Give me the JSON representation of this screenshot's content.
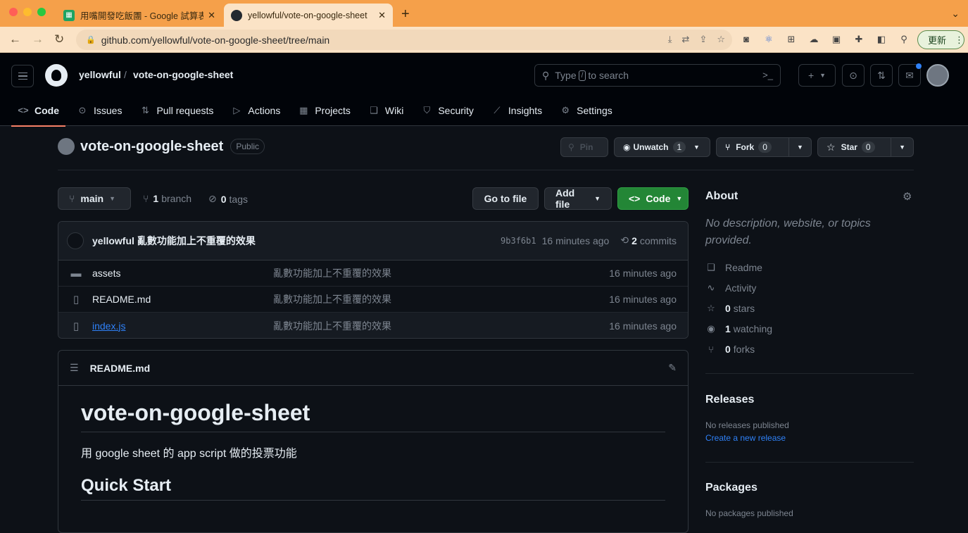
{
  "browser": {
    "tabs": [
      {
        "title": "用嘴開發吃飯團 - Google 試算表",
        "active": false
      },
      {
        "title": "yellowful/vote-on-google-sheet",
        "active": true
      }
    ],
    "url": "github.com/yellowful/vote-on-google-sheet/tree/main",
    "update_label": "更新"
  },
  "header": {
    "owner": "yellowful",
    "separator": "/",
    "repo": "vote-on-google-sheet",
    "search_before": "Type",
    "search_key": "/",
    "search_after": "to search"
  },
  "repo_nav": [
    {
      "label": "Code",
      "icon": "code-icon"
    },
    {
      "label": "Issues",
      "icon": "issue-icon"
    },
    {
      "label": "Pull requests",
      "icon": "pull-request-icon"
    },
    {
      "label": "Actions",
      "icon": "play-icon"
    },
    {
      "label": "Projects",
      "icon": "table-icon"
    },
    {
      "label": "Wiki",
      "icon": "book-icon"
    },
    {
      "label": "Security",
      "icon": "shield-icon"
    },
    {
      "label": "Insights",
      "icon": "graph-icon"
    },
    {
      "label": "Settings",
      "icon": "gear-icon"
    }
  ],
  "repo": {
    "name": "vote-on-google-sheet",
    "visibility": "Public",
    "pin_label": "Pin",
    "unwatch_label": "Unwatch",
    "watch_count": "1",
    "fork_label": "Fork",
    "fork_count": "0",
    "star_label": "Star",
    "star_count": "0"
  },
  "branch_bar": {
    "branch": "main",
    "branch_count": "1",
    "branch_label": "branch",
    "tag_count": "0",
    "tag_label": "tags",
    "go_to_file": "Go to file",
    "add_file": "Add file",
    "code": "Code"
  },
  "latest_commit": {
    "author": "yellowful",
    "message": "亂數功能加上不重覆的效果",
    "sha": "9b3f6b1",
    "age": "16 minutes ago",
    "commit_count": "2",
    "commit_label": "commits"
  },
  "files": [
    {
      "type": "folder",
      "name": "assets",
      "message": "亂數功能加上不重覆的效果",
      "age": "16 minutes ago"
    },
    {
      "type": "file",
      "name": "README.md",
      "message": "亂數功能加上不重覆的效果",
      "age": "16 minutes ago"
    },
    {
      "type": "file",
      "name": "index.js",
      "message": "亂數功能加上不重覆的效果",
      "age": "16 minutes ago"
    }
  ],
  "readme": {
    "filename": "README.md",
    "h1": "vote-on-google-sheet",
    "p": "用 google sheet 的 app script 做的投票功能",
    "h2": "Quick Start"
  },
  "about": {
    "title": "About",
    "description": "No description, website, or topics provided.",
    "items": [
      {
        "icon": "book-icon",
        "bold": "",
        "label": "Readme"
      },
      {
        "icon": "pulse-icon",
        "bold": "",
        "label": "Activity"
      },
      {
        "icon": "star-icon",
        "bold": "0",
        "label": "stars"
      },
      {
        "icon": "eye-icon",
        "bold": "1",
        "label": "watching"
      },
      {
        "icon": "fork-icon",
        "bold": "0",
        "label": "forks"
      }
    ]
  },
  "releases": {
    "title": "Releases",
    "empty": "No releases published",
    "create_link": "Create a new release"
  },
  "packages": {
    "title": "Packages",
    "empty": "No packages published"
  }
}
